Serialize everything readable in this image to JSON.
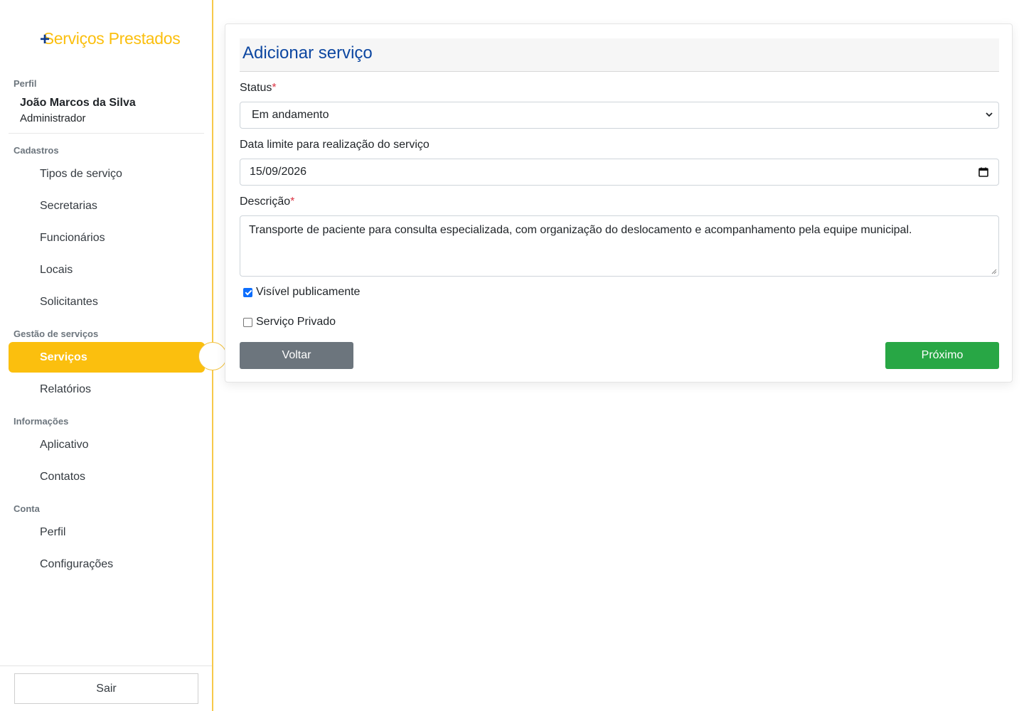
{
  "brand": {
    "plus": "+",
    "name": "Serviços Prestados"
  },
  "sidebar": {
    "profile_label": "Perfil",
    "profile_name": "João Marcos da Silva",
    "profile_role": "Administrador",
    "sections": {
      "cadastros": "Cadastros",
      "gestao": "Gestão de serviços",
      "informacoes": "Informações",
      "conta": "Conta"
    },
    "items": {
      "tipos": "Tipos de serviço",
      "secretarias": "Secretarias",
      "funcionarios": "Funcionários",
      "locais": "Locais",
      "solicitantes": "Solicitantes",
      "servicos": "Serviços",
      "relatorios": "Relatórios",
      "aplicativo": "Aplicativo",
      "contatos": "Contatos",
      "perfil": "Perfil",
      "configuracoes": "Configurações"
    },
    "logout": "Sair"
  },
  "form": {
    "title": "Adicionar serviço",
    "status_label": "Status",
    "required_mark": "*",
    "status_value": "Em andamento",
    "deadline_label": "Data limite para realização do serviço",
    "deadline_value": "15/09/2026",
    "description_label": "Descrição",
    "description_value": "Transporte de paciente para consulta especializada, com organização do deslocamento e acompanhamento pela equipe municipal.",
    "public_label": "Visível publicamente",
    "public_checked": true,
    "private_label": "Serviço Privado",
    "private_checked": false,
    "back_button": "Voltar",
    "next_button": "Próximo"
  },
  "colors": {
    "accent": "#fbbf0e",
    "title_blue": "#0d47a1",
    "success": "#28a745",
    "secondary": "#6c757d"
  }
}
